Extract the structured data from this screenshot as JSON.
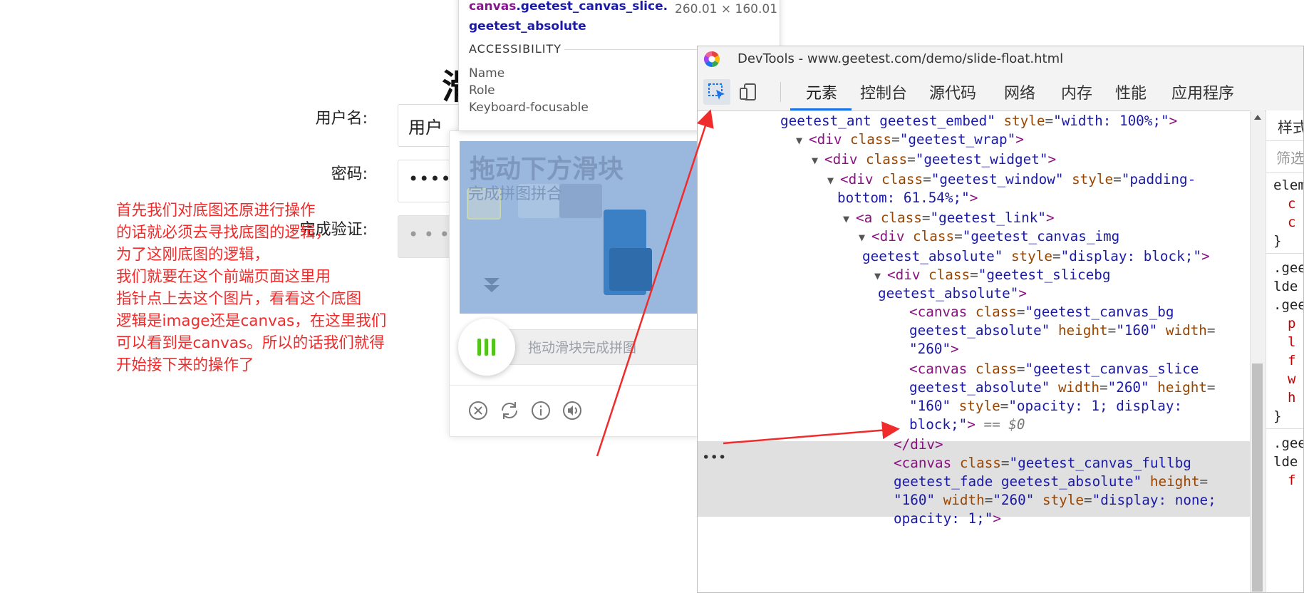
{
  "page": {
    "title_partial": "滑",
    "labels": {
      "username": "用户名:",
      "password": "密码:",
      "verify": "完成验证:"
    },
    "username_value": "用户",
    "password_value": "••••••",
    "verify_placeholder": "• • •"
  },
  "annotation": {
    "lines": [
      "首先我们对底图还原进行操作",
      "的话就必须去寻找底图的逻辑，",
      "为了这刚底图的逻辑，",
      "我们就要在这个前端页面这里用",
      "指针点上去这个图片，看看这个底图",
      "逻辑是image还是canvas，在这里我们",
      "可以看到是canvas。所以的话我们就得",
      "开始接下来的操作了"
    ],
    "color": "#f02b2b"
  },
  "captcha": {
    "image_title": "拖动下方滑块",
    "image_subtitle": "完成拼图拼合",
    "slider_hint": "拖动滑块完成拼图",
    "accent": "#52c41a"
  },
  "tooltip": {
    "selector_tag": "canvas",
    "selector_classes": ".geetest_canvas_slice.geetest_absolute",
    "size": "260.01 × 160.01",
    "section": "ACCESSIBILITY",
    "rows": [
      "Name",
      "Role",
      "Keyboard-focusable"
    ]
  },
  "devtools": {
    "title": "DevTools - www.geetest.com/demo/slide-float.html",
    "tabs": [
      "元素",
      "控制台",
      "源代码",
      "网络",
      "内存",
      "性能",
      "应用程序"
    ],
    "styles_tab": "样式",
    "styles_filter": "筛选",
    "styles_lines": [
      "elem",
      "c",
      "c",
      "}",
      ".gee",
      "lde",
      ".gee",
      "p",
      "l",
      "f",
      "w",
      "h",
      "}",
      ".gee",
      "lde",
      "f"
    ],
    "selected_marker": "== $0",
    "dom": {
      "l1": {
        "val": "geetest_ant geetest_embed",
        "attr": "style",
        "val2": "width: 100%;"
      },
      "l2": {
        "tag": "div",
        "attr": "class",
        "val": "geetest_wrap"
      },
      "l3": {
        "tag": "div",
        "attr": "class",
        "val": "geetest_widget"
      },
      "l4": {
        "tag": "div",
        "attr": "class",
        "val": "geetest_window",
        "attr2": "style",
        "val2a": "padding-",
        "val2b": "bottom: 61.54%;"
      },
      "l5": {
        "tag": "a",
        "attr": "class",
        "val": "geetest_link"
      },
      "l6": {
        "tag": "div",
        "attr": "class",
        "val_a": "geetest_canvas_img",
        "val_b": "geetest_absolute",
        "attr2": "style",
        "val2": "display: block;"
      },
      "l7": {
        "tag": "div",
        "attr": "class",
        "val_a": "geetest_slicebg",
        "val_b": "geetest_absolute"
      },
      "l8": {
        "tag": "canvas",
        "attr": "class",
        "val_a": "geetest_canvas_bg",
        "val_b": "geetest_absolute",
        "attr2": "height",
        "val2": "160",
        "attr3": "width",
        "val3": "260"
      },
      "l9": {
        "tag": "canvas",
        "attr": "class",
        "val_a": "geetest_canvas_slice",
        "val_b": "geetest_absolute",
        "attr2": "width",
        "val2": "260",
        "attr3": "height",
        "val3": "160",
        "attr4": "style",
        "val4a": "opacity: 1; display:",
        "val4b": "block;"
      },
      "l10": {
        "tag": "div"
      },
      "l11": {
        "tag": "canvas",
        "attr": "class",
        "val_a": "geetest_canvas_fullbg",
        "val_b": "geetest_fade geetest_absolute",
        "attr2": "height",
        "val2": "160",
        "attr3": "width",
        "val3": "260",
        "attr4": "style",
        "val4a": "display: none;",
        "val4b": "opacity: 1;"
      }
    }
  }
}
